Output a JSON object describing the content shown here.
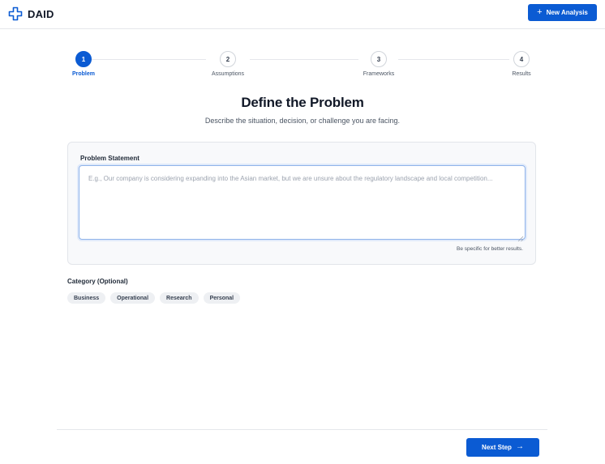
{
  "header": {
    "brand_name": "DAID",
    "new_analysis_label": "New Analysis"
  },
  "stepper": {
    "current_step": 1,
    "steps": [
      {
        "number": "1",
        "label": "Problem"
      },
      {
        "number": "2",
        "label": "Assumptions"
      },
      {
        "number": "3",
        "label": "Frameworks"
      },
      {
        "number": "4",
        "label": "Results"
      }
    ]
  },
  "main": {
    "title": "Define the Problem",
    "subtitle": "Describe the situation, decision, or challenge you are facing.",
    "problem_statement": {
      "label": "Problem Statement",
      "value": "",
      "placeholder": "E.g., Our company is considering expanding into the Asian market, but we are unsure about the regulatory landscape and local competition...",
      "hint": "Be specific for better results."
    },
    "category": {
      "label": "Category (Optional)",
      "options": [
        "Business",
        "Operational",
        "Research",
        "Personal"
      ]
    }
  },
  "footer": {
    "next_label": "Next Step"
  },
  "colors": {
    "primary": "#0b5bd3",
    "border": "#e5e7eb",
    "card_bg": "#f8f9fb",
    "chip_bg": "#eef0f3"
  },
  "icons": {
    "brand": "medical-cross-icon",
    "new_analysis": "plus-icon",
    "next": "arrow-right-icon"
  }
}
